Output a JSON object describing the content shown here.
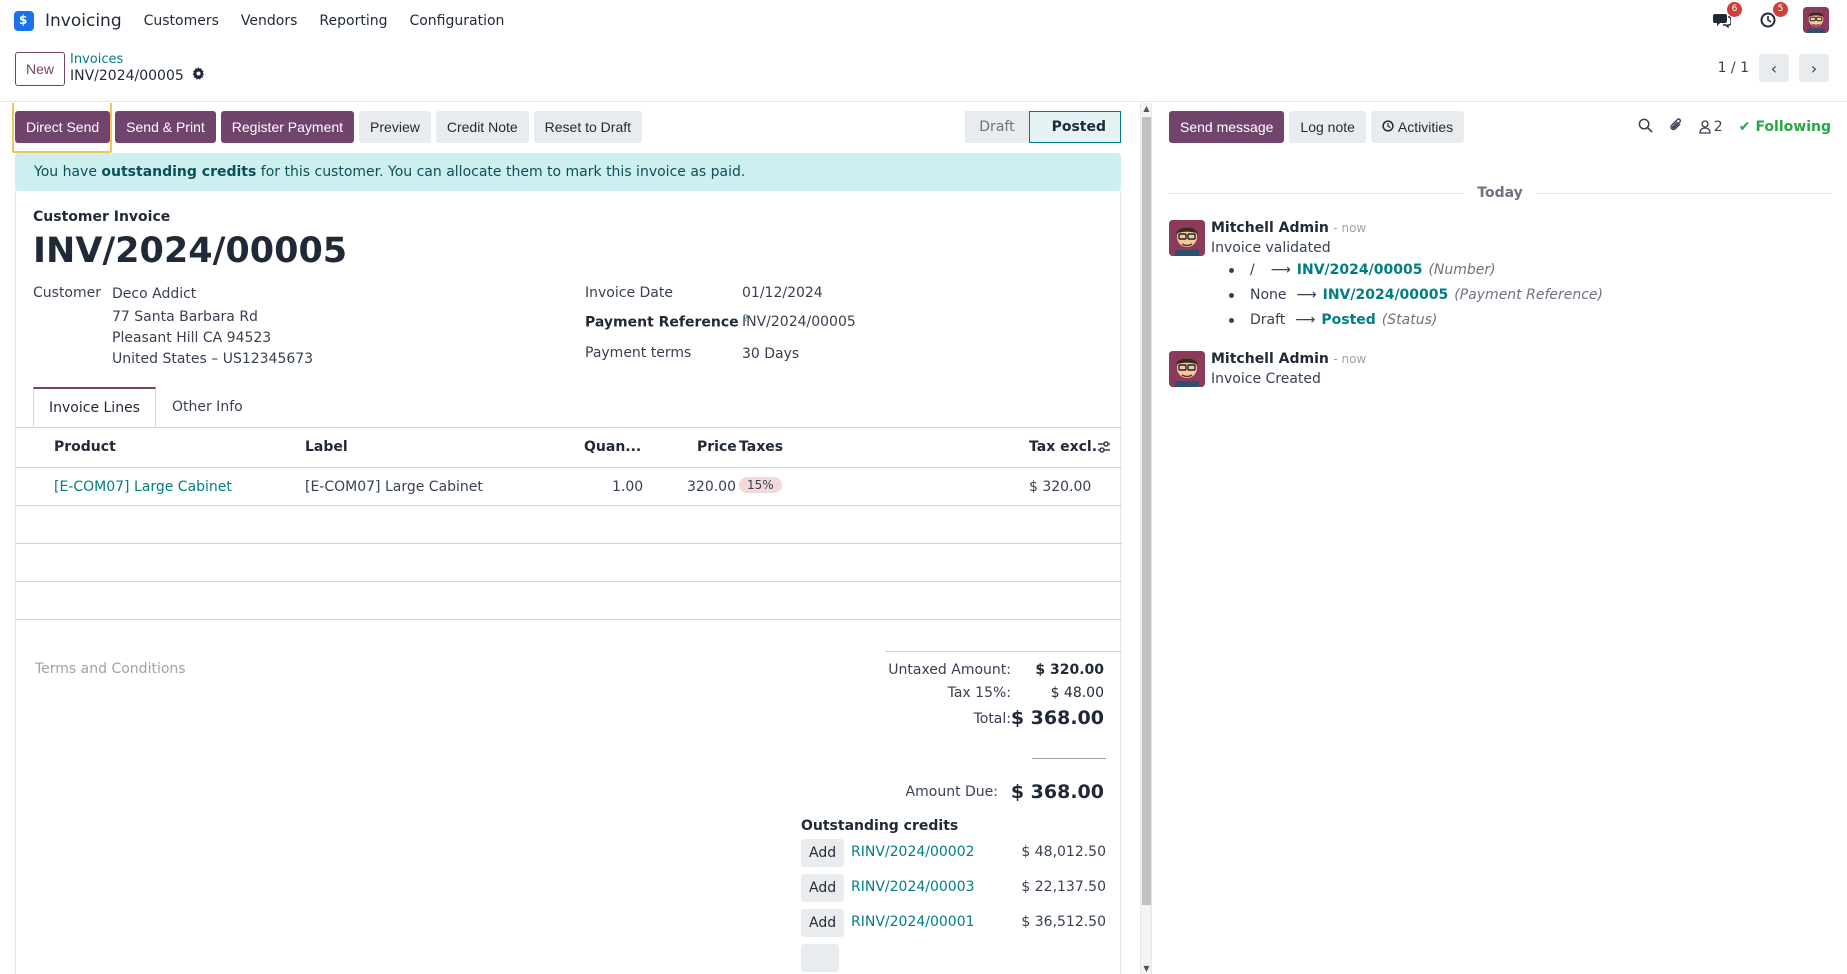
{
  "navbar": {
    "app_name": "Invoicing",
    "menu": [
      "Customers",
      "Vendors",
      "Reporting",
      "Configuration"
    ],
    "messages_badge": "6",
    "activities_badge": "5"
  },
  "control": {
    "new_label": "New",
    "breadcrumb_parent": "Invoices",
    "breadcrumb_current": "INV/2024/00005",
    "pager": "1 / 1"
  },
  "actions": {
    "direct_send": "Direct Send",
    "send_print": "Send & Print",
    "register_payment": "Register Payment",
    "preview": "Preview",
    "credit_note": "Credit Note",
    "reset_draft": "Reset to Draft"
  },
  "status": {
    "draft": "Draft",
    "posted": "Posted"
  },
  "alert": {
    "prefix": "You have ",
    "bold": "outstanding credits",
    "suffix": " for this customer. You can allocate them to mark this invoice as paid."
  },
  "invoice": {
    "doc_type": "Customer Invoice",
    "name": "INV/2024/00005",
    "customer_label": "Customer",
    "customer": "Deco Addict",
    "address_1": "77 Santa Barbara Rd",
    "address_2": "Pleasant Hill CA 94523",
    "address_3": "United States – US12345673",
    "invoice_date_label": "Invoice Date",
    "invoice_date": "01/12/2024",
    "payment_ref_label": "Payment Reference",
    "payment_ref_help": "?",
    "payment_ref": "INV/2024/00005",
    "payment_terms_label": "Payment terms",
    "payment_terms": "30 Days"
  },
  "tabs": [
    "Invoice Lines",
    "Other Info"
  ],
  "lines": {
    "headers": {
      "product": "Product",
      "label": "Label",
      "qty": "Quan...",
      "price": "Price",
      "taxes": "Taxes",
      "tax_excl": "Tax excl."
    },
    "rows": [
      {
        "product": "[E-COM07] Large Cabinet",
        "label": "[E-COM07] Large Cabinet",
        "qty": "1.00",
        "price": "320.00",
        "tax": "15%",
        "subtotal": "$ 320.00"
      }
    ]
  },
  "terms_placeholder": "Terms and Conditions",
  "totals": {
    "untaxed_label": "Untaxed Amount:",
    "untaxed": "$ 320.00",
    "tax_label": "Tax 15%:",
    "tax": "$ 48.00",
    "total_label": "Total:",
    "total": "$ 368.00",
    "due_label": "Amount Due:",
    "due": "$ 368.00"
  },
  "outstanding": {
    "title": "Outstanding credits",
    "add_label": "Add",
    "items": [
      {
        "ref": "RINV/2024/00002",
        "amount": "$ 48,012.50"
      },
      {
        "ref": "RINV/2024/00003",
        "amount": "$ 22,137.50"
      },
      {
        "ref": "RINV/2024/00001",
        "amount": "$ 36,512.50"
      }
    ]
  },
  "chatter": {
    "send_message": "Send message",
    "log_note": "Log note",
    "activities": "Activities",
    "followers_count": "2",
    "following": "Following",
    "today": "Today",
    "messages": [
      {
        "author": "Mitchell Admin",
        "time": "- now",
        "body": "Invoice validated",
        "tracking": [
          {
            "old": "/",
            "new": "INV/2024/00005",
            "field": "(Number)"
          },
          {
            "old": "None",
            "new": "INV/2024/00005",
            "field": "(Payment Reference)"
          },
          {
            "old": "Draft",
            "new": "Posted",
            "field": "(Status)"
          }
        ]
      },
      {
        "author": "Mitchell Admin",
        "time": "- now",
        "body": "Invoice Created"
      }
    ]
  },
  "colors": {
    "primary": "#71456b",
    "link": "#017e84",
    "alert_bg": "#cdeff0",
    "highlight": "#f5c453",
    "following": "#28a745"
  }
}
